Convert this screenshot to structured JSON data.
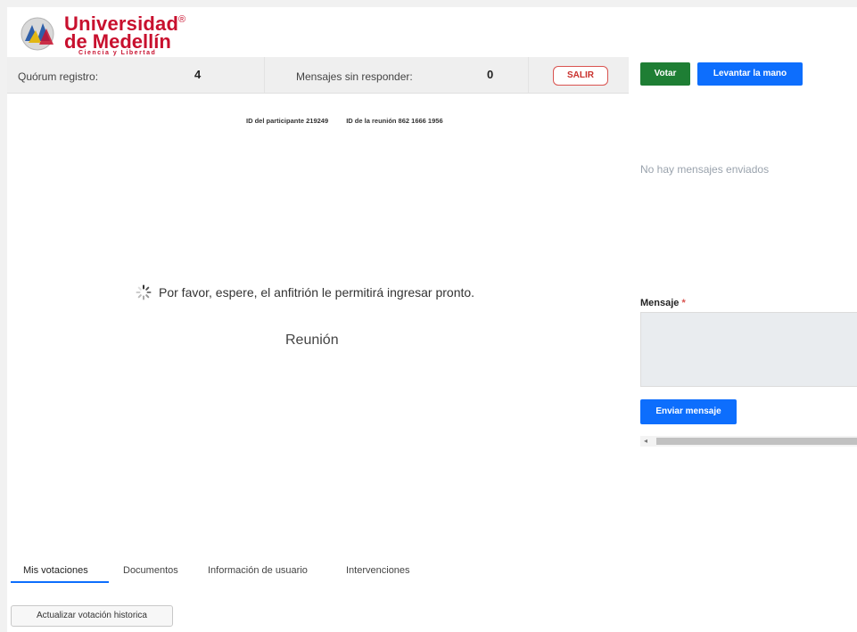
{
  "logo": {
    "line1": "Universidad",
    "line2": "de Medellín",
    "registered": "®",
    "tagline": "Ciencia y Libertad"
  },
  "stats": {
    "quorum_label": "Quórum registro:",
    "quorum_value": "4",
    "unanswered_label": "Mensajes sin responder:",
    "unanswered_value": "0",
    "exit_label": "SALIR"
  },
  "meeting": {
    "participant_id": "ID del participante 219249",
    "meeting_id": "ID de la reunión 862 1666 1956",
    "waiting_text": "Por favor, espere, el anfitrión le permitirá ingresar pronto.",
    "title": "Reunión"
  },
  "tabs": [
    {
      "label": "Mis votaciones",
      "active": true
    },
    {
      "label": "Documentos",
      "active": false
    },
    {
      "label": "Información de usuario",
      "active": false
    },
    {
      "label": "Intervenciones",
      "active": false
    }
  ],
  "historic_button": "Actualizar votación historica",
  "right_panel": {
    "vote_button": "Votar",
    "raise_hand_button": "Levantar la mano",
    "no_messages": "No hay mensajes enviados",
    "message_label": "Mensaje",
    "required_mark": "*",
    "message_value": "",
    "send_button": "Enviar mensaje"
  },
  "colors": {
    "brand_red": "#c8102e",
    "vote_green": "#1e7e34",
    "primary_blue": "#0d6efd",
    "exit_red": "#d9534f"
  }
}
